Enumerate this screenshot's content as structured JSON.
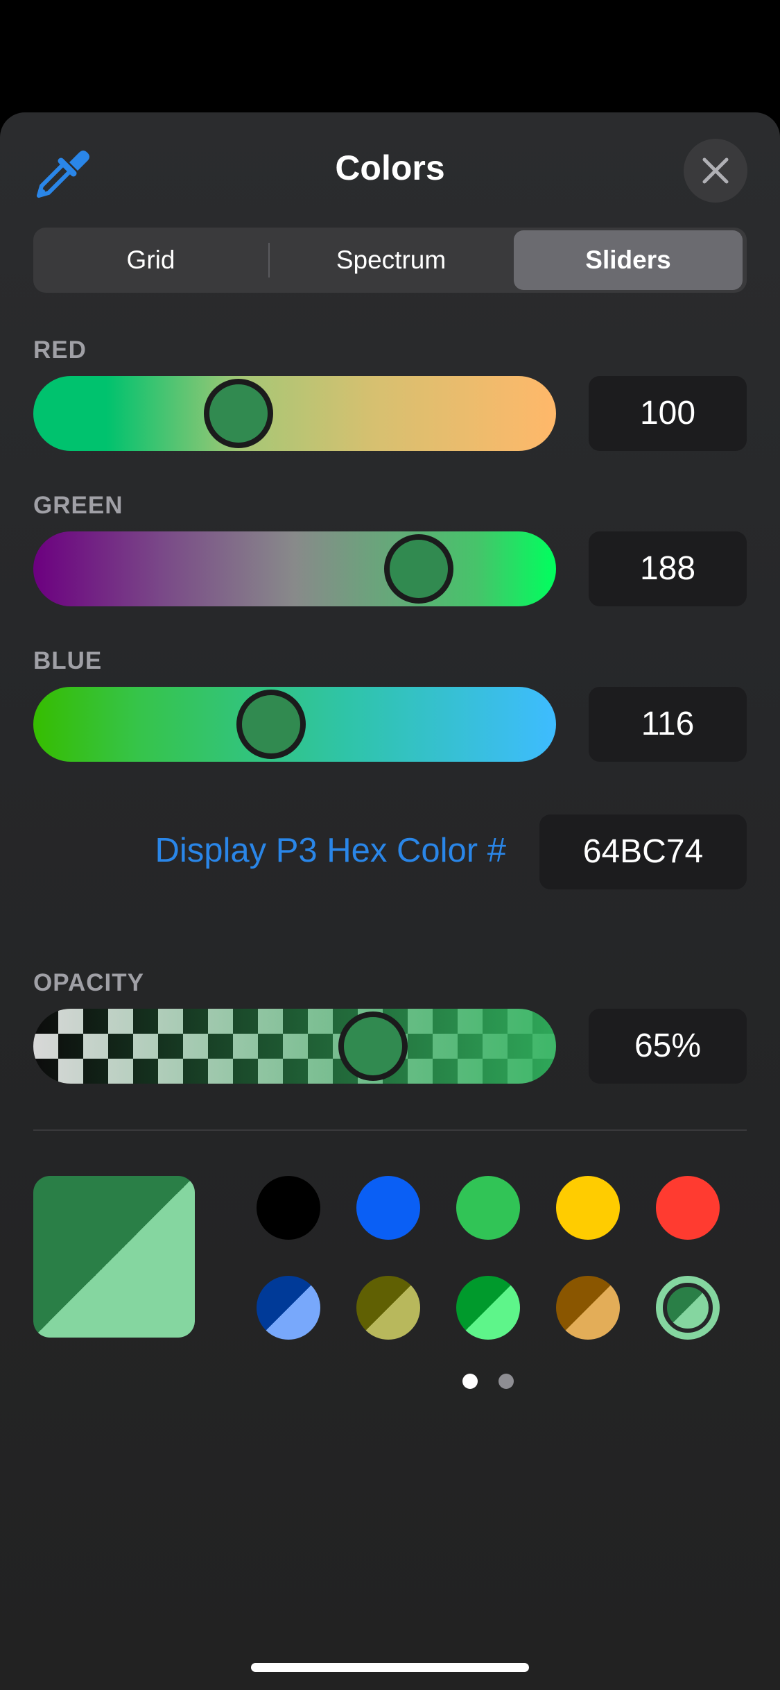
{
  "header": {
    "title": "Colors",
    "eyedropper_icon": "eyedropper-icon",
    "close_icon": "close-icon"
  },
  "tabs": [
    {
      "label": "Grid",
      "selected": false
    },
    {
      "label": "Spectrum",
      "selected": false
    },
    {
      "label": "Sliders",
      "selected": true
    }
  ],
  "sliders": {
    "red": {
      "label": "RED",
      "value": "100",
      "fraction": 0.392
    },
    "green": {
      "label": "GREEN",
      "value": "188",
      "fraction": 0.737
    },
    "blue": {
      "label": "BLUE",
      "value": "116",
      "fraction": 0.455
    }
  },
  "hex": {
    "label": "Display P3 Hex Color #",
    "value": "64BC74"
  },
  "opacity": {
    "label": "OPACITY",
    "value": "65%",
    "fraction": 0.65
  },
  "current_color": {
    "solid": "#2a7f47",
    "translucent": "#85d6a0"
  },
  "swatches": [
    {
      "name": "black",
      "a": "#000000",
      "b": "#000000"
    },
    {
      "name": "blue",
      "a": "#0a5ff5",
      "b": "#0a5ff5"
    },
    {
      "name": "green",
      "a": "#31c456",
      "b": "#31c456"
    },
    {
      "name": "yellow",
      "a": "#ffcc00",
      "b": "#ffcc00"
    },
    {
      "name": "red",
      "a": "#ff3b30",
      "b": "#ff3b30"
    },
    {
      "name": "blue-alpha",
      "a": "#003a98",
      "b": "#78a8fb"
    },
    {
      "name": "olive-alpha",
      "a": "#606003",
      "b": "#b8b85c"
    },
    {
      "name": "green-alpha",
      "a": "#009a2c",
      "b": "#5ef58a"
    },
    {
      "name": "orange-alpha",
      "a": "#8a5600",
      "b": "#e3ad58"
    },
    {
      "name": "custom-selected",
      "a": "#2a7f47",
      "b": "#85d6a0"
    }
  ],
  "page_dots": {
    "count": 2,
    "current": 1
  },
  "colors": {
    "accent": "#2a86e8",
    "background": "#000000",
    "sheet": "#262729"
  }
}
